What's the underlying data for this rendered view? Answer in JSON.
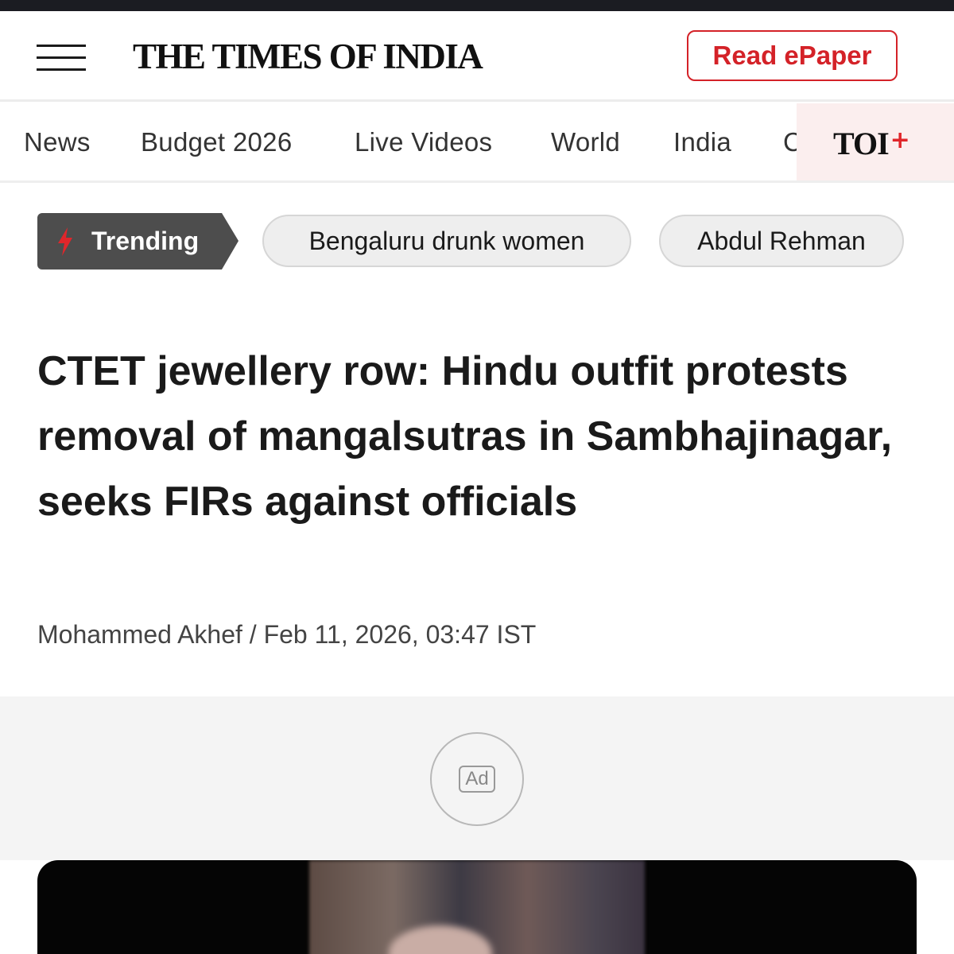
{
  "header": {
    "logo_text": "THE TIMES OF INDIA",
    "epaper_label": "Read ePaper",
    "accent_color": "#d42228"
  },
  "nav": {
    "items": [
      {
        "label": "News"
      },
      {
        "label": "Budget 2026"
      },
      {
        "label": "Live Videos"
      },
      {
        "label": "World"
      },
      {
        "label": "India"
      },
      {
        "label": "C"
      }
    ],
    "toi_plus": {
      "text": "TOI",
      "symbol": "+"
    }
  },
  "trending": {
    "label": "Trending",
    "icon": "lightning-bolt-icon",
    "topics": [
      "Bengaluru drunk women",
      "Abdul Rehman"
    ]
  },
  "article": {
    "headline": "CTET jewellery row: Hindu outfit protests removal of mangalsutras in Sambhajinagar, seeks FIRs against officials",
    "byline": "Mohammed Akhef / Feb 11, 2026, 03:47 IST"
  },
  "ad": {
    "label": "Ad"
  }
}
